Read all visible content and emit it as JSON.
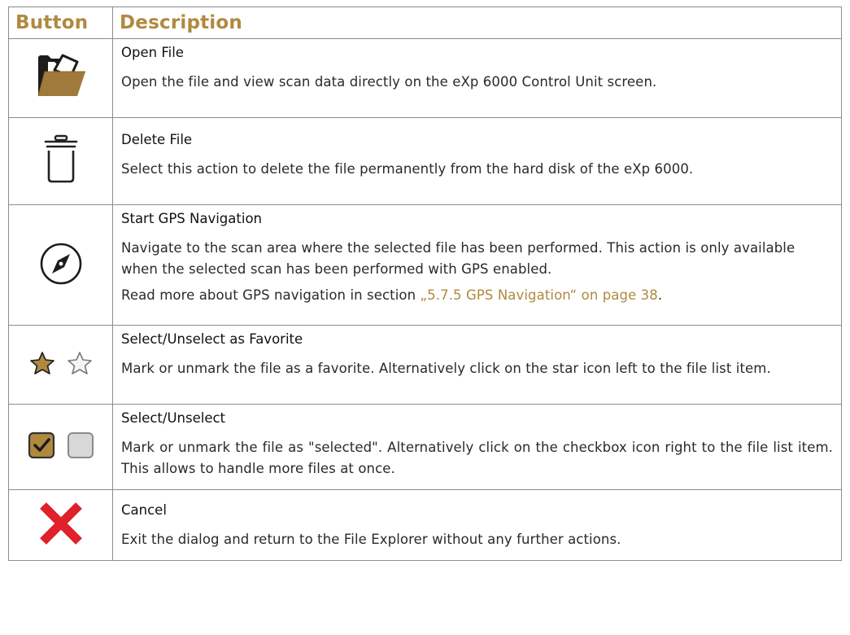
{
  "header": {
    "col1": "Button",
    "col2": "Description"
  },
  "rows": [
    {
      "icon": "open-folder-icon",
      "title": "Open File",
      "text": "Open the file and view scan data directly on the eXp 6000 Control Unit screen."
    },
    {
      "icon": "trash-icon",
      "title": "Delete File",
      "text": "Select this action to delete the file permanently from the hard disk of the eXp 6000."
    },
    {
      "icon": "compass-icon",
      "title": "Start GPS Navigation",
      "text": "Navigate to the scan area where the selected file has been performed. This action is only available when the selected scan has been performed with GPS enabled.",
      "more_prefix": "Read more about GPS navigation in section ",
      "more_link": "„5.7.5 GPS Navigation“ on page 38",
      "more_suffix": "."
    },
    {
      "icon": "star-icon",
      "title": "Select/Unselect as Favorite",
      "text": "Mark or unmark the file as a favorite. Alternatively click on the star icon left to the file list item."
    },
    {
      "icon": "checkbox-icon",
      "title": "Select/Unselect",
      "text": "Mark or unmark the file as \"selected\". Alternatively click on the checkbox icon right to the file list item. This allows to handle more files at once."
    },
    {
      "icon": "cancel-x-icon",
      "title": "Cancel",
      "text": "Exit the dialog and return to the File Explorer without any further actions."
    }
  ],
  "colors": {
    "accent": "#b0893f",
    "cancel": "#e0202a",
    "border": "#8c8c8c"
  }
}
